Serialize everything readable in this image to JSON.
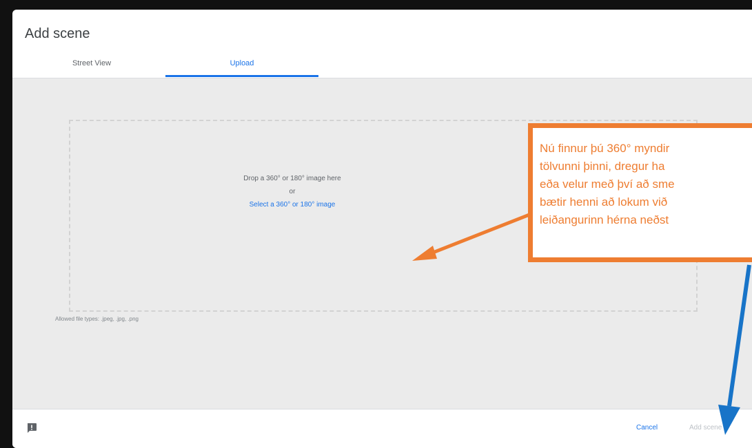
{
  "dialog": {
    "title": "Add scene",
    "tabs": [
      {
        "label": "Street View",
        "active": false
      },
      {
        "label": "Upload",
        "active": true
      }
    ]
  },
  "upload": {
    "drop_text": "Drop a 360° or 180° image here",
    "or_text": "or",
    "select_link": "Select a 360° or 180° image",
    "allowed_types": "Allowed file types: .jpeg, .jpg, .png"
  },
  "footer": {
    "feedback_icon": "feedback-icon",
    "cancel_label": "Cancel",
    "add_label": "Add scene"
  },
  "annotation": {
    "lines": [
      "Nú finnur þú 360° myndir",
      "tölvunni þinni, dregur ha",
      "eða velur með því að sme",
      "bætir henni að lokum við",
      "leiðangurinn hérna neðst"
    ]
  },
  "colors": {
    "accent": "#1a73e8",
    "callout": "#ee7d31",
    "pointer_arrow": "#1874c8"
  }
}
